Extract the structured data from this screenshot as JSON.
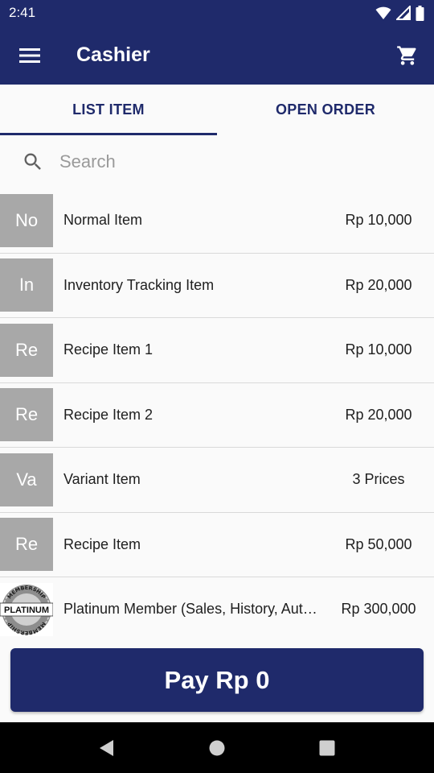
{
  "status_bar": {
    "time": "2:41",
    "icons": [
      "wifi-icon",
      "signal-icon",
      "battery-icon"
    ]
  },
  "app_bar": {
    "title": "Cashier",
    "menu_icon": "menu-icon",
    "cart_icon": "cart-icon"
  },
  "tabs": [
    {
      "label": "LIST ITEM",
      "active": true
    },
    {
      "label": "OPEN ORDER",
      "active": false
    }
  ],
  "search": {
    "placeholder": "Search",
    "value": ""
  },
  "items": [
    {
      "thumb": "No",
      "name": "Normal Item",
      "price": "Rp 10,000"
    },
    {
      "thumb": "In",
      "name": "Inventory Tracking Item",
      "price": "Rp 20,000"
    },
    {
      "thumb": "Re",
      "name": "Recipe Item 1",
      "price": "Rp 10,000"
    },
    {
      "thumb": "Re",
      "name": "Recipe Item 2",
      "price": "Rp 20,000"
    },
    {
      "thumb": "Va",
      "name": "Variant Item",
      "price": "3 Prices"
    },
    {
      "thumb": "Re",
      "name": "Recipe Item",
      "price": "Rp 50,000"
    },
    {
      "thumb": "PLATINUM",
      "badge_arc_top": "MEMBERSHIP",
      "badge_arc_bottom": "MEMBERSHIP",
      "name": "Platinum Member (Sales, History, Aut…",
      "price": "Rp 300,000"
    }
  ],
  "pay_button": {
    "label": "Pay Rp 0"
  },
  "colors": {
    "primary": "#1f2a6b",
    "thumb_bg": "#a8a8a8",
    "background": "#fafafa",
    "divider": "#d9d9d9"
  },
  "nav_bar": {
    "icons": [
      "back-icon",
      "home-icon",
      "recents-icon"
    ]
  }
}
